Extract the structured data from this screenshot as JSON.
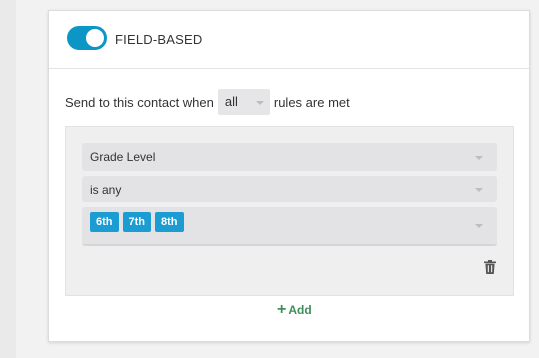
{
  "header": {
    "toggle_label": "FIELD-BASED",
    "toggle_on": true
  },
  "rule_line": {
    "prefix": "Send to this contact when",
    "match_value": "all",
    "suffix": "rules are met"
  },
  "rule": {
    "field": "Grade Level",
    "operator": "is any",
    "values": [
      "6th",
      "7th",
      "8th"
    ]
  },
  "actions": {
    "add_label": "Add"
  },
  "icons": {
    "delete": "trash-icon",
    "add": "plus-icon",
    "caret": "caret-down-icon"
  },
  "colors": {
    "toggle": "#0b96c6",
    "chip": "#1b9cd2",
    "add": "#3f8e5b"
  }
}
